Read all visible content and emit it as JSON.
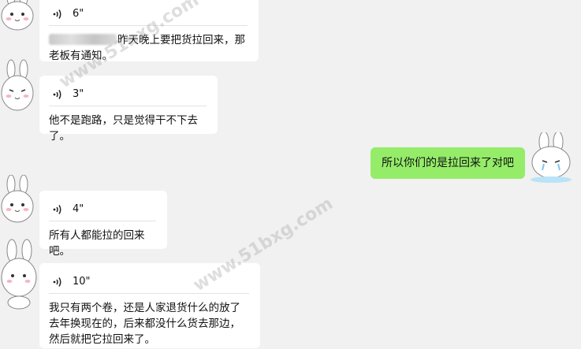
{
  "messages": [
    {
      "duration": "6\"",
      "text": "昨天晚上要把货拉回来，那老板有通知。"
    },
    {
      "duration": "3\"",
      "text": "他不是跑路，只是觉得干不下去了。"
    },
    {
      "text": "所以你们的是拉回来了对吧"
    },
    {
      "duration": "4\"",
      "text": "所有人都能拉的回来吧。"
    },
    {
      "duration": "10\"",
      "text": "我只有两个卷，还是人家退货什么的放了去年换现在的，后来都没什么货去那边，然后就把它拉回来了。"
    }
  ],
  "watermark": "www.51bxg.com",
  "colors": {
    "background": "#f1f1f1",
    "incoming_bubble": "#ffffff",
    "outgoing_bubble": "#95ec69"
  }
}
